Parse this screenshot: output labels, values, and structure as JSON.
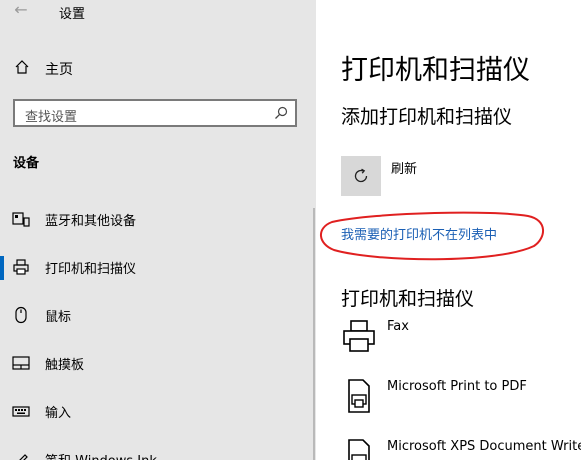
{
  "window": {
    "title": "设置",
    "back_glyph": "←"
  },
  "sidebar": {
    "home_label": "主页",
    "search_placeholder": "查找设置",
    "section_title": "设备",
    "items": [
      {
        "label": "蓝牙和其他设备",
        "icon": "bluetooth-devices-icon"
      },
      {
        "label": "打印机和扫描仪",
        "icon": "printer-icon",
        "active": true
      },
      {
        "label": "鼠标",
        "icon": "mouse-icon"
      },
      {
        "label": "触摸板",
        "icon": "touchpad-icon"
      },
      {
        "label": "输入",
        "icon": "keyboard-icon"
      },
      {
        "label": "笔和 Windows Ink",
        "icon": "pen-icon"
      }
    ]
  },
  "main": {
    "page_title": "打印机和扫描仪",
    "add_section_title": "添加打印机和扫描仪",
    "refresh_label": "刷新",
    "missing_printer_link": "我需要的打印机不在列表中",
    "printers_section_title": "打印机和扫描仪",
    "devices": [
      {
        "label": "Fax",
        "icon": "fax-icon"
      },
      {
        "label": "Microsoft Print to PDF",
        "icon": "printer-icon"
      },
      {
        "label": "Microsoft XPS Document Writer",
        "icon": "printer-icon"
      }
    ]
  },
  "colors": {
    "accent": "#0067c0",
    "link": "#1a5fb4",
    "annotation": "#e02020",
    "sidebar_bg": "#e6e6e6"
  }
}
